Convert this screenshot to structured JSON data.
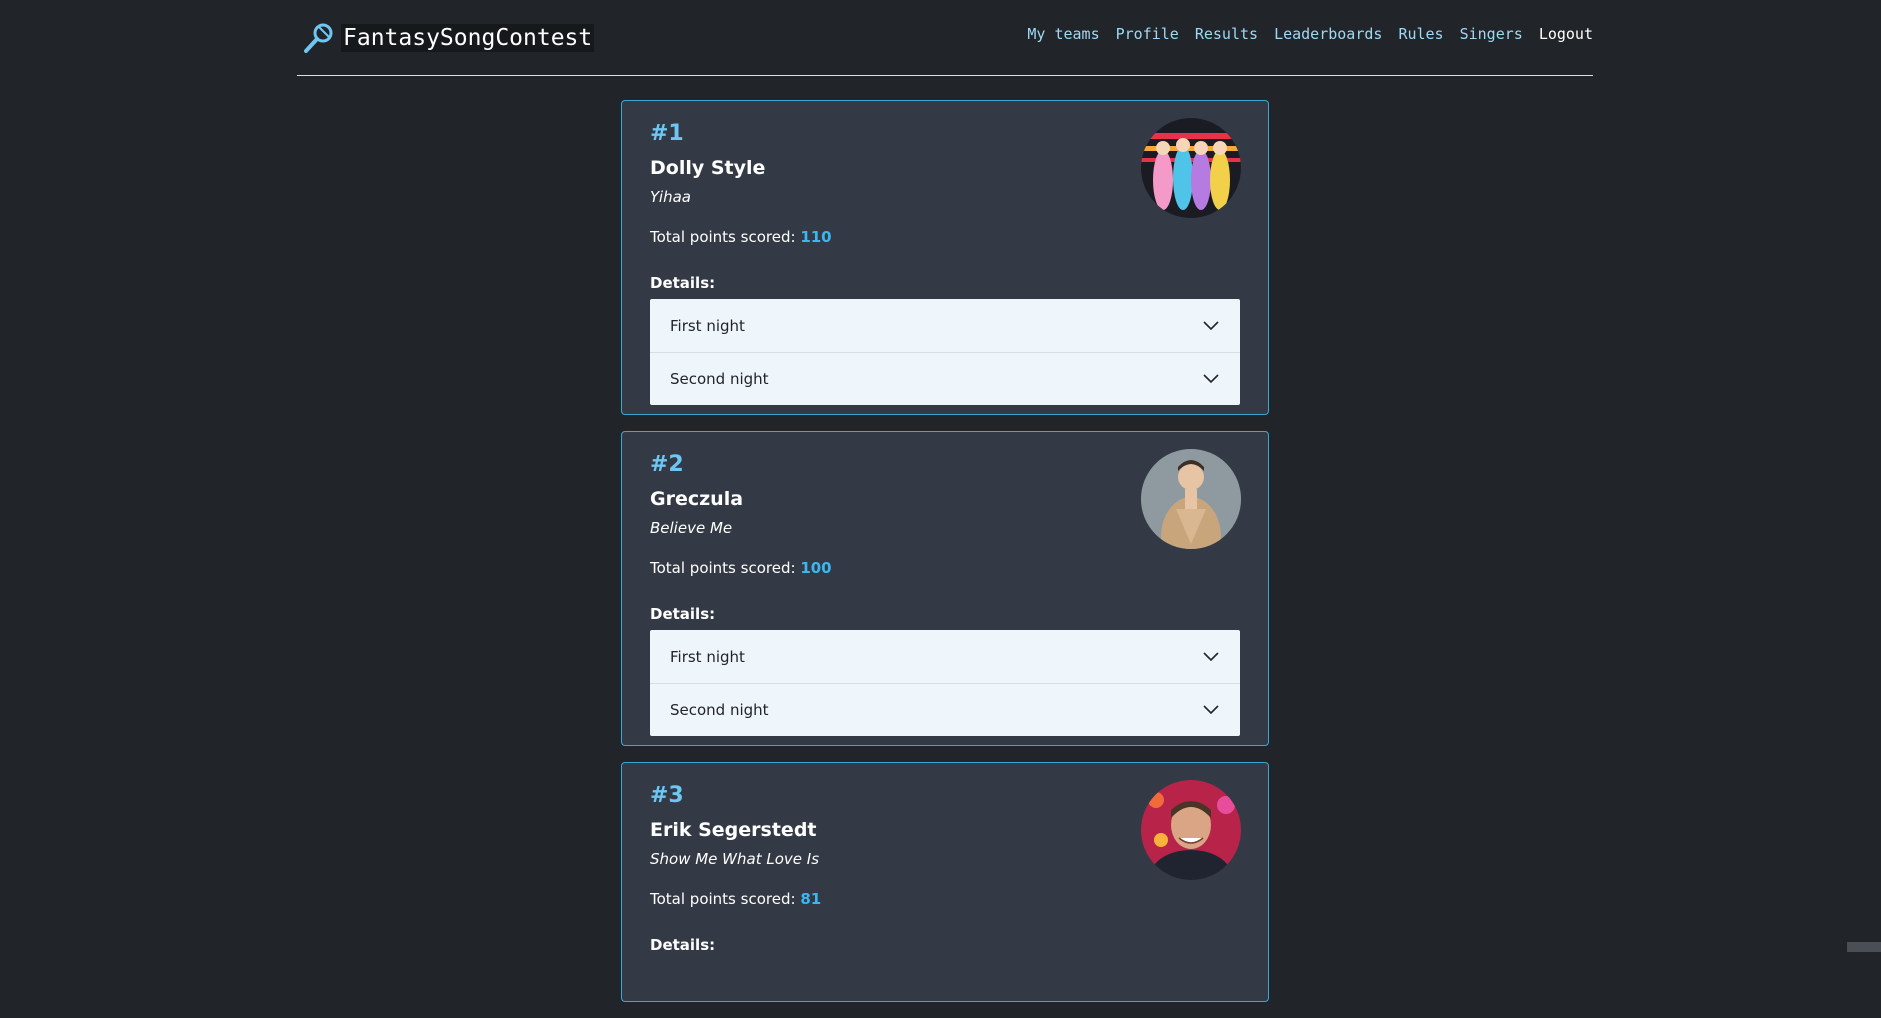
{
  "header": {
    "brand": "FantasySongContest",
    "nav": [
      "My teams",
      "Profile",
      "Results",
      "Leaderboards",
      "Rules",
      "Singers"
    ],
    "logout": "Logout"
  },
  "cards": [
    {
      "rank": "#1",
      "singer": "Dolly Style",
      "song": "Yihaa",
      "points_label": "Total points scored:",
      "points": "110",
      "details_label": "Details:",
      "nights": [
        "First night",
        "Second night"
      ]
    },
    {
      "rank": "#2",
      "singer": "Greczula",
      "song": "Believe Me",
      "points_label": "Total points scored:",
      "points": "100",
      "details_label": "Details:",
      "nights": [
        "First night",
        "Second night"
      ]
    },
    {
      "rank": "#3",
      "singer": "Erik Segerstedt",
      "song": "Show Me What Love Is",
      "points_label": "Total points scored:",
      "points": "81",
      "details_label": "Details:"
    }
  ],
  "colors": {
    "background": "#212529",
    "card": "#343a45",
    "accent": "#38b7f0",
    "nav_link": "#9fd8f5"
  }
}
